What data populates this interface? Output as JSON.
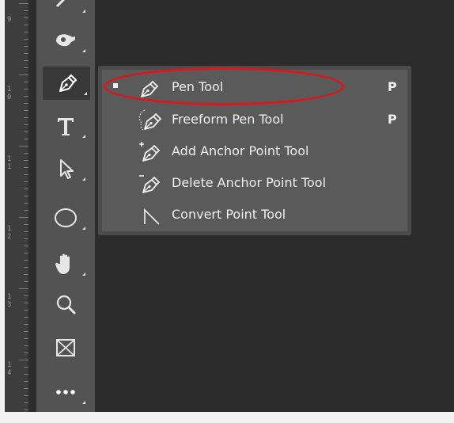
{
  "ruler": {
    "numbers": [
      "9",
      "1\n0",
      "1\n1",
      "1\n2",
      "1\n3",
      "1\n4"
    ]
  },
  "toolbar": {
    "tools": [
      {
        "name": "partial-tool-icon"
      },
      {
        "name": "burn-tool-icon"
      },
      {
        "name": "pen-tool-icon",
        "active": true
      },
      {
        "name": "type-tool-icon"
      },
      {
        "name": "path-selection-tool-icon"
      },
      {
        "name": "ellipse-tool-icon"
      },
      {
        "name": "hand-tool-icon"
      },
      {
        "name": "zoom-tool-icon"
      },
      {
        "name": "frame-tool-icon"
      },
      {
        "name": "more-tools-icon"
      }
    ]
  },
  "flyout": {
    "items": [
      {
        "label": "Pen Tool",
        "shortcut": "P",
        "selected": true,
        "icon": "pen-icon"
      },
      {
        "label": "Freeform Pen Tool",
        "shortcut": "P",
        "selected": false,
        "icon": "freeform-pen-icon"
      },
      {
        "label": "Add Anchor Point Tool",
        "shortcut": "",
        "selected": false,
        "icon": "add-anchor-point-icon"
      },
      {
        "label": "Delete Anchor Point Tool",
        "shortcut": "",
        "selected": false,
        "icon": "delete-anchor-point-icon"
      },
      {
        "label": "Convert Point Tool",
        "shortcut": "",
        "selected": false,
        "icon": "convert-point-icon"
      }
    ]
  },
  "colors": {
    "highlight": "#e0151a",
    "toolbar_bg": "#535353",
    "flyout_bg": "#5a5a5a",
    "canvas_bg": "#2b2b2b"
  }
}
